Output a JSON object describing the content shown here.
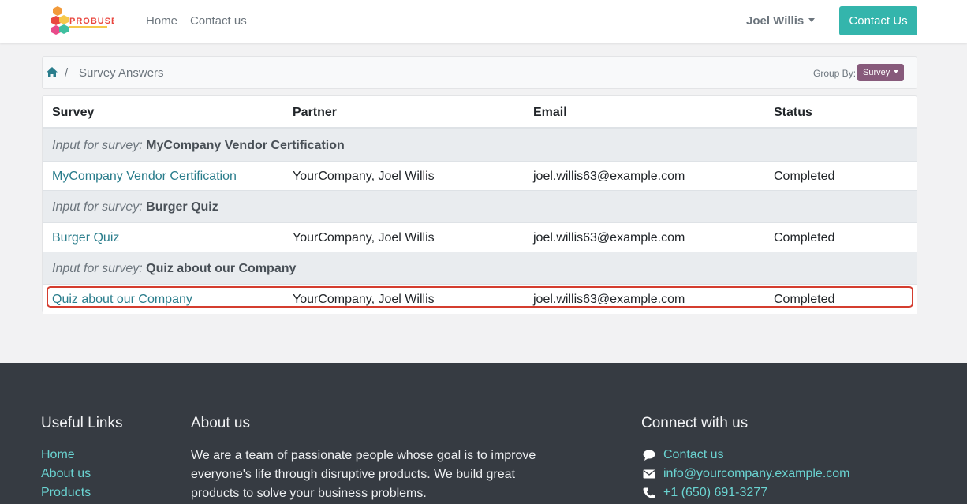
{
  "header": {
    "nav": {
      "home": "Home",
      "contact": "Contact us"
    },
    "user": "Joel Willis",
    "contact_button": "Contact Us",
    "logo_text": "PROBUSE"
  },
  "breadcrumb": {
    "current": "Survey Answers",
    "separator": "/",
    "group_by_label": "Group By:",
    "group_by_value": "Survey"
  },
  "table": {
    "headers": [
      "Survey",
      "Partner",
      "Email",
      "Status"
    ],
    "group_prefix": "Input for survey:",
    "groups": [
      {
        "name": "MyCompany Vendor Certification",
        "row": {
          "survey": "MyCompany Vendor Certification",
          "partner": "YourCompany, Joel Willis",
          "email": "joel.willis63@example.com",
          "status": "Completed"
        }
      },
      {
        "name": "Burger Quiz",
        "row": {
          "survey": "Burger Quiz",
          "partner": "YourCompany, Joel Willis",
          "email": "joel.willis63@example.com",
          "status": "Completed"
        }
      },
      {
        "name": "Quiz about our Company",
        "row": {
          "survey": "Quiz about our Company",
          "partner": "YourCompany, Joel Willis",
          "email": "joel.willis63@example.com",
          "status": "Completed"
        }
      }
    ]
  },
  "footer": {
    "useful_links": {
      "title": "Useful Links",
      "items": [
        "Home",
        "About us",
        "Products"
      ]
    },
    "about": {
      "title": "About us",
      "text": "We are a team of passionate people whose goal is to improve everyone's life through disruptive products. We build great products to solve your business problems."
    },
    "connect": {
      "title": "Connect with us",
      "contact": "Contact us",
      "email": "info@yourcompany.example.com",
      "phone": "+1 (650) 691-3277"
    }
  },
  "colors": {
    "accent": "#34b5ac",
    "link": "#2a7d8c",
    "group_by_button": "#875a7b",
    "highlight": "#d43d2f",
    "footer_bg": "#363b42",
    "footer_link": "#6ad3d1"
  },
  "icons": [
    "home-icon",
    "comment-icon",
    "envelope-icon",
    "phone-icon"
  ]
}
